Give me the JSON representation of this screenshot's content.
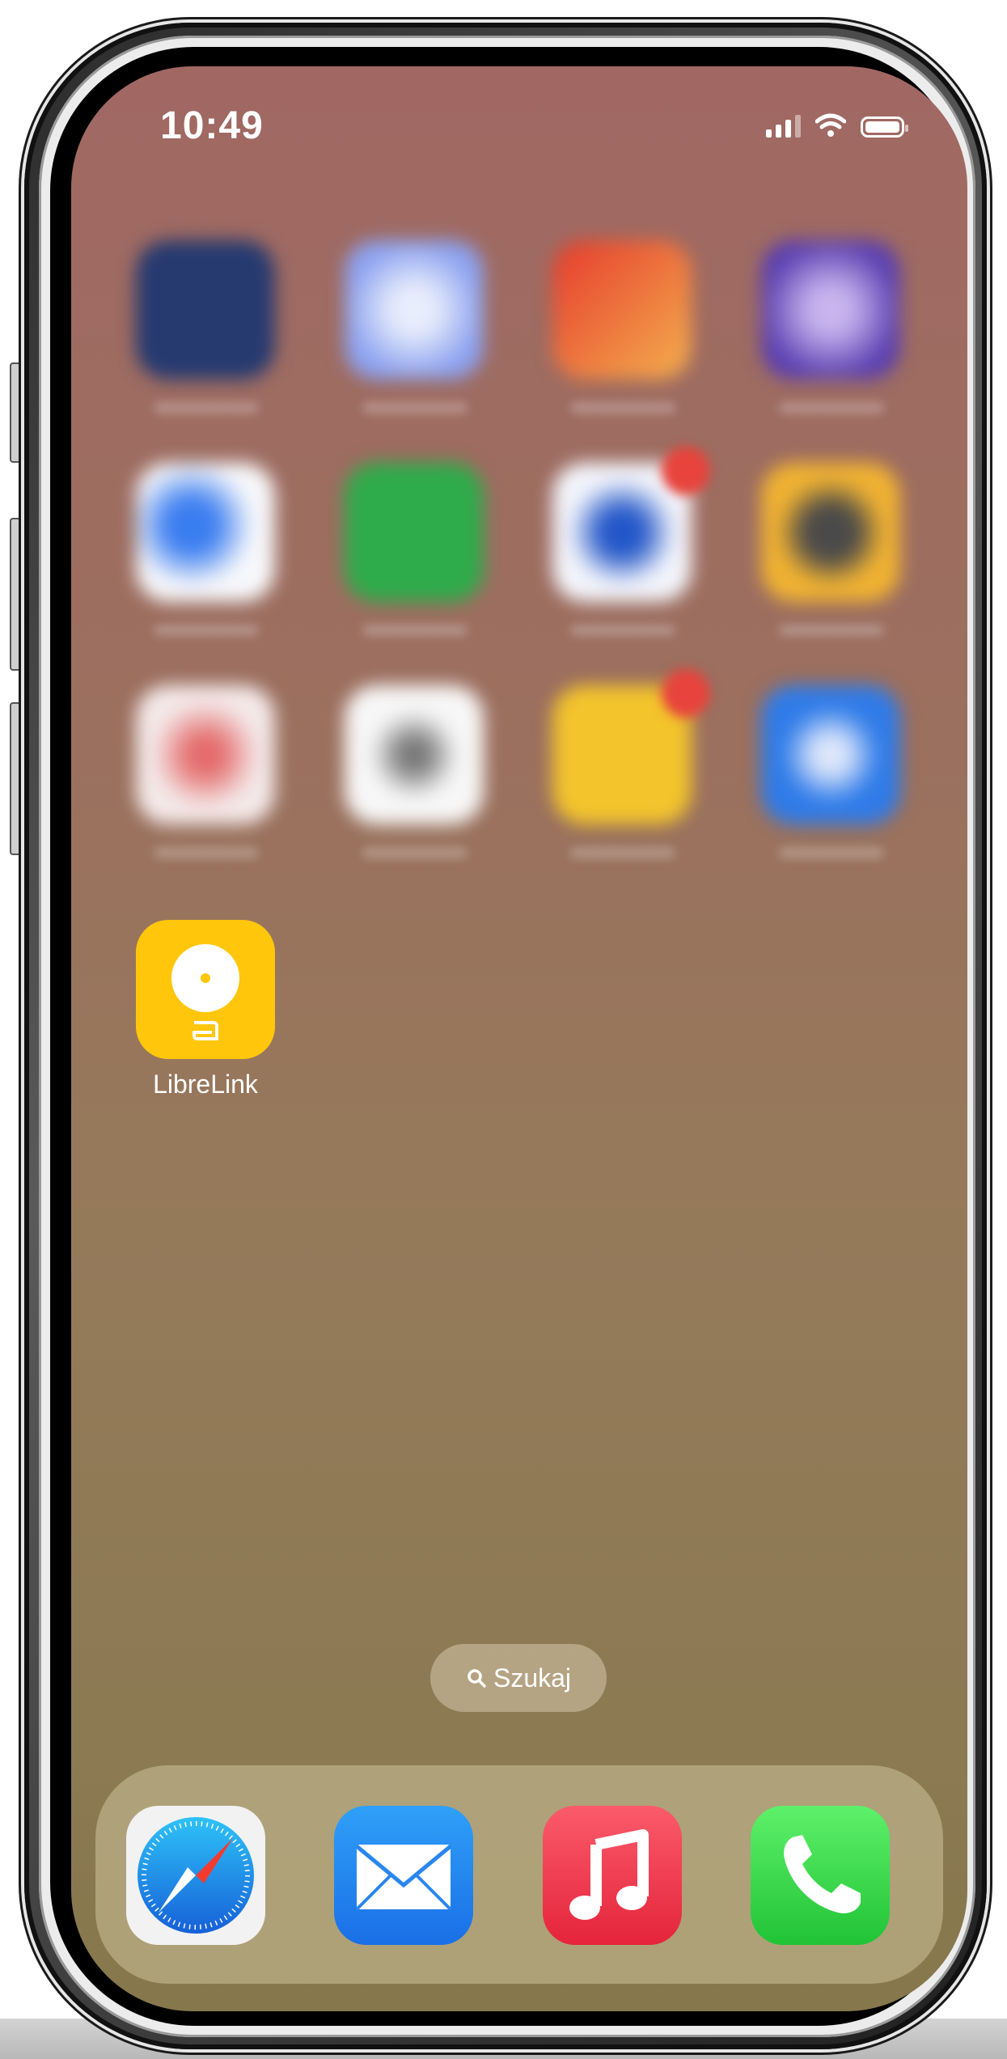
{
  "status_bar": {
    "time": "10:49"
  },
  "home_screen": {
    "app_label": "LibreLink",
    "search_label": "Szukaj"
  },
  "dock": {
    "apps": [
      "Safari",
      "Mail",
      "Music",
      "Phone"
    ]
  },
  "colors": {
    "libre_yellow": "#ffc60b",
    "badge_red": "#e8433c"
  }
}
